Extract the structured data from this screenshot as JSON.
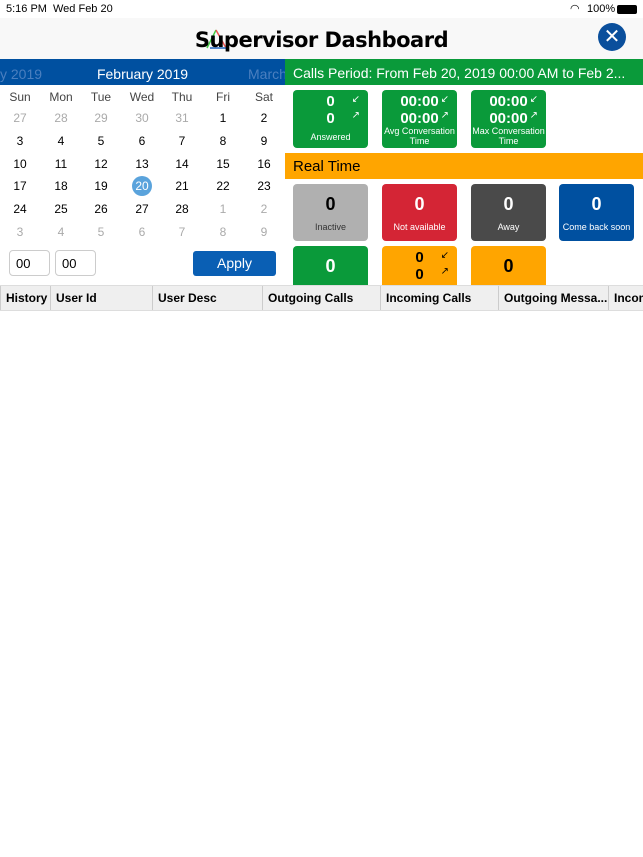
{
  "status": {
    "time": "5:16 PM",
    "date": "Wed Feb 20",
    "battery": "100%"
  },
  "header": {
    "title": "Supervisor Dashboard",
    "close_icon": "close-icon"
  },
  "calendar": {
    "prev": "y 2019",
    "current": "February 2019",
    "next": "March",
    "weekdays": [
      "Sun",
      "Mon",
      "Tue",
      "Wed",
      "Thu",
      "Fri",
      "Sat"
    ],
    "weeks": [
      [
        "27",
        "28",
        "29",
        "30",
        "31",
        "1",
        "2"
      ],
      [
        "3",
        "4",
        "5",
        "6",
        "7",
        "8",
        "9"
      ],
      [
        "10",
        "11",
        "12",
        "13",
        "14",
        "15",
        "16"
      ],
      [
        "17",
        "18",
        "19",
        "20",
        "21",
        "22",
        "23"
      ],
      [
        "24",
        "25",
        "26",
        "27",
        "28",
        "1",
        "2"
      ],
      [
        "3",
        "4",
        "5",
        "6",
        "7",
        "8",
        "9"
      ]
    ],
    "selected": "20",
    "hour": "00",
    "minute": "00",
    "apply": "Apply"
  },
  "calls": {
    "period": "Calls Period: From Feb 20, 2019 00:00 AM to Feb 2...",
    "tiles": [
      {
        "in": "0",
        "out": "0",
        "label": "Answered"
      },
      {
        "in": "00:00",
        "out": "00:00",
        "label": "Avg Conversation Time"
      },
      {
        "in": "00:00",
        "out": "00:00",
        "label": "Max Conversation Time"
      }
    ]
  },
  "realtime": {
    "title": "Real Time",
    "tiles": [
      {
        "value": "0",
        "label": "Inactive",
        "color": "#b0b0b0"
      },
      {
        "value": "0",
        "label": "Not available",
        "color": "#d42535"
      },
      {
        "value": "0",
        "label": "Away",
        "color": "#4a4a4a"
      },
      {
        "value": "0",
        "label": "Come back soon",
        "color": "#0050a0"
      }
    ],
    "row3": [
      {
        "value": "0",
        "color": "#0a9a3a"
      },
      {
        "in": "0",
        "out": "0",
        "color": "#ffa500"
      },
      {
        "value": "0",
        "color": "#ffa500"
      }
    ]
  },
  "table": {
    "columns": [
      "History",
      "User Id",
      "User Desc",
      "Outgoing Calls",
      "Incoming Calls",
      "Outgoing Messa...",
      "Incom"
    ]
  }
}
